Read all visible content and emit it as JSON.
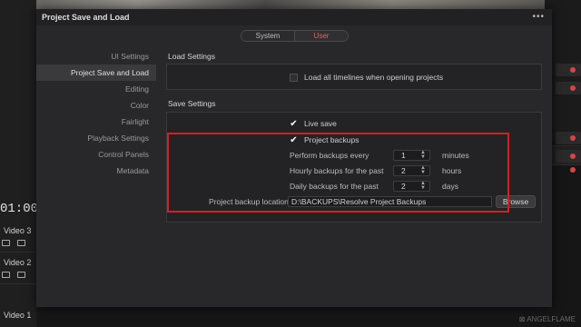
{
  "background": {
    "timecode": "01:00:0",
    "tracks": [
      "Video 3",
      "Video 2",
      "Video 1"
    ],
    "watermark": "⊠ ANGELFLAME"
  },
  "dialog": {
    "title": "Project Save and Load",
    "more_icon": "more-dots-icon",
    "tabs": {
      "system": "System",
      "user": "User"
    },
    "sidebar": [
      {
        "label": "UI Settings"
      },
      {
        "label": "Project Save and Load"
      },
      {
        "label": "Editing"
      },
      {
        "label": "Color"
      },
      {
        "label": "Fairlight"
      },
      {
        "label": "Playback Settings"
      },
      {
        "label": "Control Panels"
      },
      {
        "label": "Metadata"
      }
    ],
    "load_settings": {
      "title": "Load Settings",
      "load_all_timelines": {
        "label": "Load all timelines when opening projects",
        "checked": false
      }
    },
    "save_settings": {
      "title": "Save Settings",
      "live_save": {
        "label": "Live save",
        "checked": true
      },
      "project_backups": {
        "label": "Project backups",
        "checked": true
      },
      "perform_every": {
        "label": "Perform backups every",
        "value": "1",
        "unit": "minutes"
      },
      "hourly": {
        "label": "Hourly backups for the past",
        "value": "2",
        "unit": "hours"
      },
      "daily": {
        "label": "Daily backups for the past",
        "value": "2",
        "unit": "days"
      },
      "location": {
        "label": "Project backup location",
        "value": "D:\\BACKUPS\\Resolve Project Backups",
        "browse": "Browse"
      }
    },
    "colors": {
      "accent": "#e0655d",
      "highlight": "#d41f26"
    }
  }
}
